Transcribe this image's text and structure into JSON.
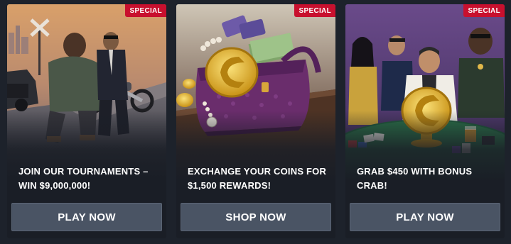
{
  "cards": [
    {
      "badge": "SPECIAL",
      "title": "JOIN OUR TOURNAMENTS – WIN $9,000,000!",
      "button": "PLAY NOW"
    },
    {
      "badge": "SPECIAL",
      "title": "EXCHANGE YOUR COINS FOR $1,500 REWARDS!",
      "button": "SHOP NOW"
    },
    {
      "badge": "SPECIAL",
      "title": "GRAB $450 WITH BONUS CRAB!",
      "button": "PLAY NOW"
    }
  ],
  "colors": {
    "background": "#1d222b",
    "card": "#1a1e26",
    "badge": "#c8102e",
    "button": "#4a5464",
    "coin_gold": "#e8b930"
  },
  "icons": {
    "card_1_art": "gangsters-on-road-illustration",
    "card_2_art": "purple-bag-with-coins-illustration",
    "card_3_art": "casino-table-crew-illustration"
  }
}
